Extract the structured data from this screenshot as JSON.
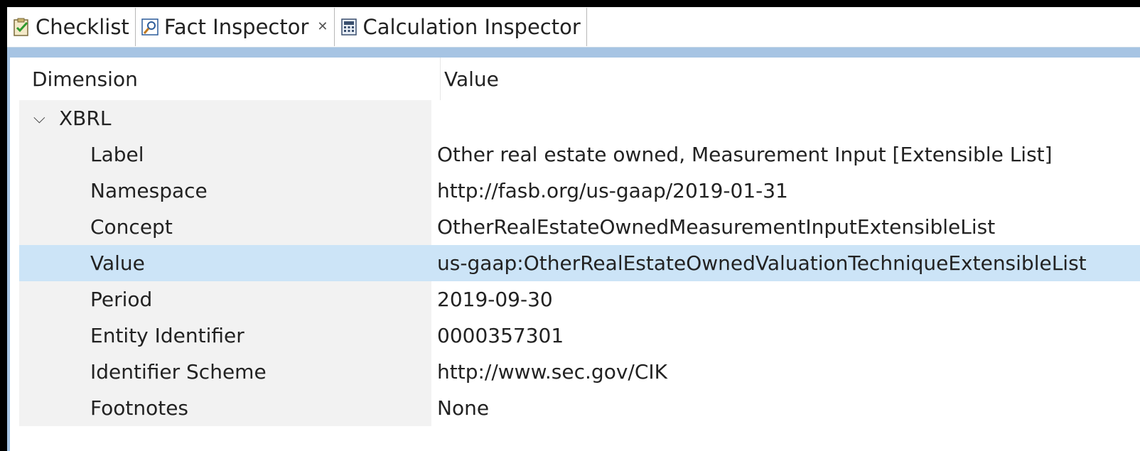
{
  "tabs": [
    {
      "label": "Checklist",
      "icon": "checklist-icon"
    },
    {
      "label": "Fact Inspector",
      "icon": "fact-inspector-icon",
      "active": true,
      "closable": true
    },
    {
      "label": "Calculation Inspector",
      "icon": "calculation-icon"
    }
  ],
  "table": {
    "columns": [
      "Dimension",
      "Value"
    ],
    "group": {
      "label": "XBRL",
      "expanded": true
    },
    "rows": [
      {
        "key": "Label",
        "value": "Other real estate owned, Measurement Input [Extensible List]"
      },
      {
        "key": "Namespace",
        "value": "http://fasb.org/us-gaap/2019-01-31"
      },
      {
        "key": "Concept",
        "value": "OtherRealEstateOwnedMeasurementInputExtensibleList"
      },
      {
        "key": "Value",
        "value": "us-gaap:OtherRealEstateOwnedValuationTechniqueExtensibleList",
        "selected": true
      },
      {
        "key": "Period",
        "value": "2019-09-30"
      },
      {
        "key": "Entity Identifier",
        "value": "0000357301"
      },
      {
        "key": "Identifier Scheme",
        "value": "http://www.sec.gov/CIK"
      },
      {
        "key": "Footnotes",
        "value": "None"
      }
    ]
  },
  "colors": {
    "selection": "#cce4f7",
    "band": "#a6c4e3",
    "key_column": "#f2f2f2"
  }
}
